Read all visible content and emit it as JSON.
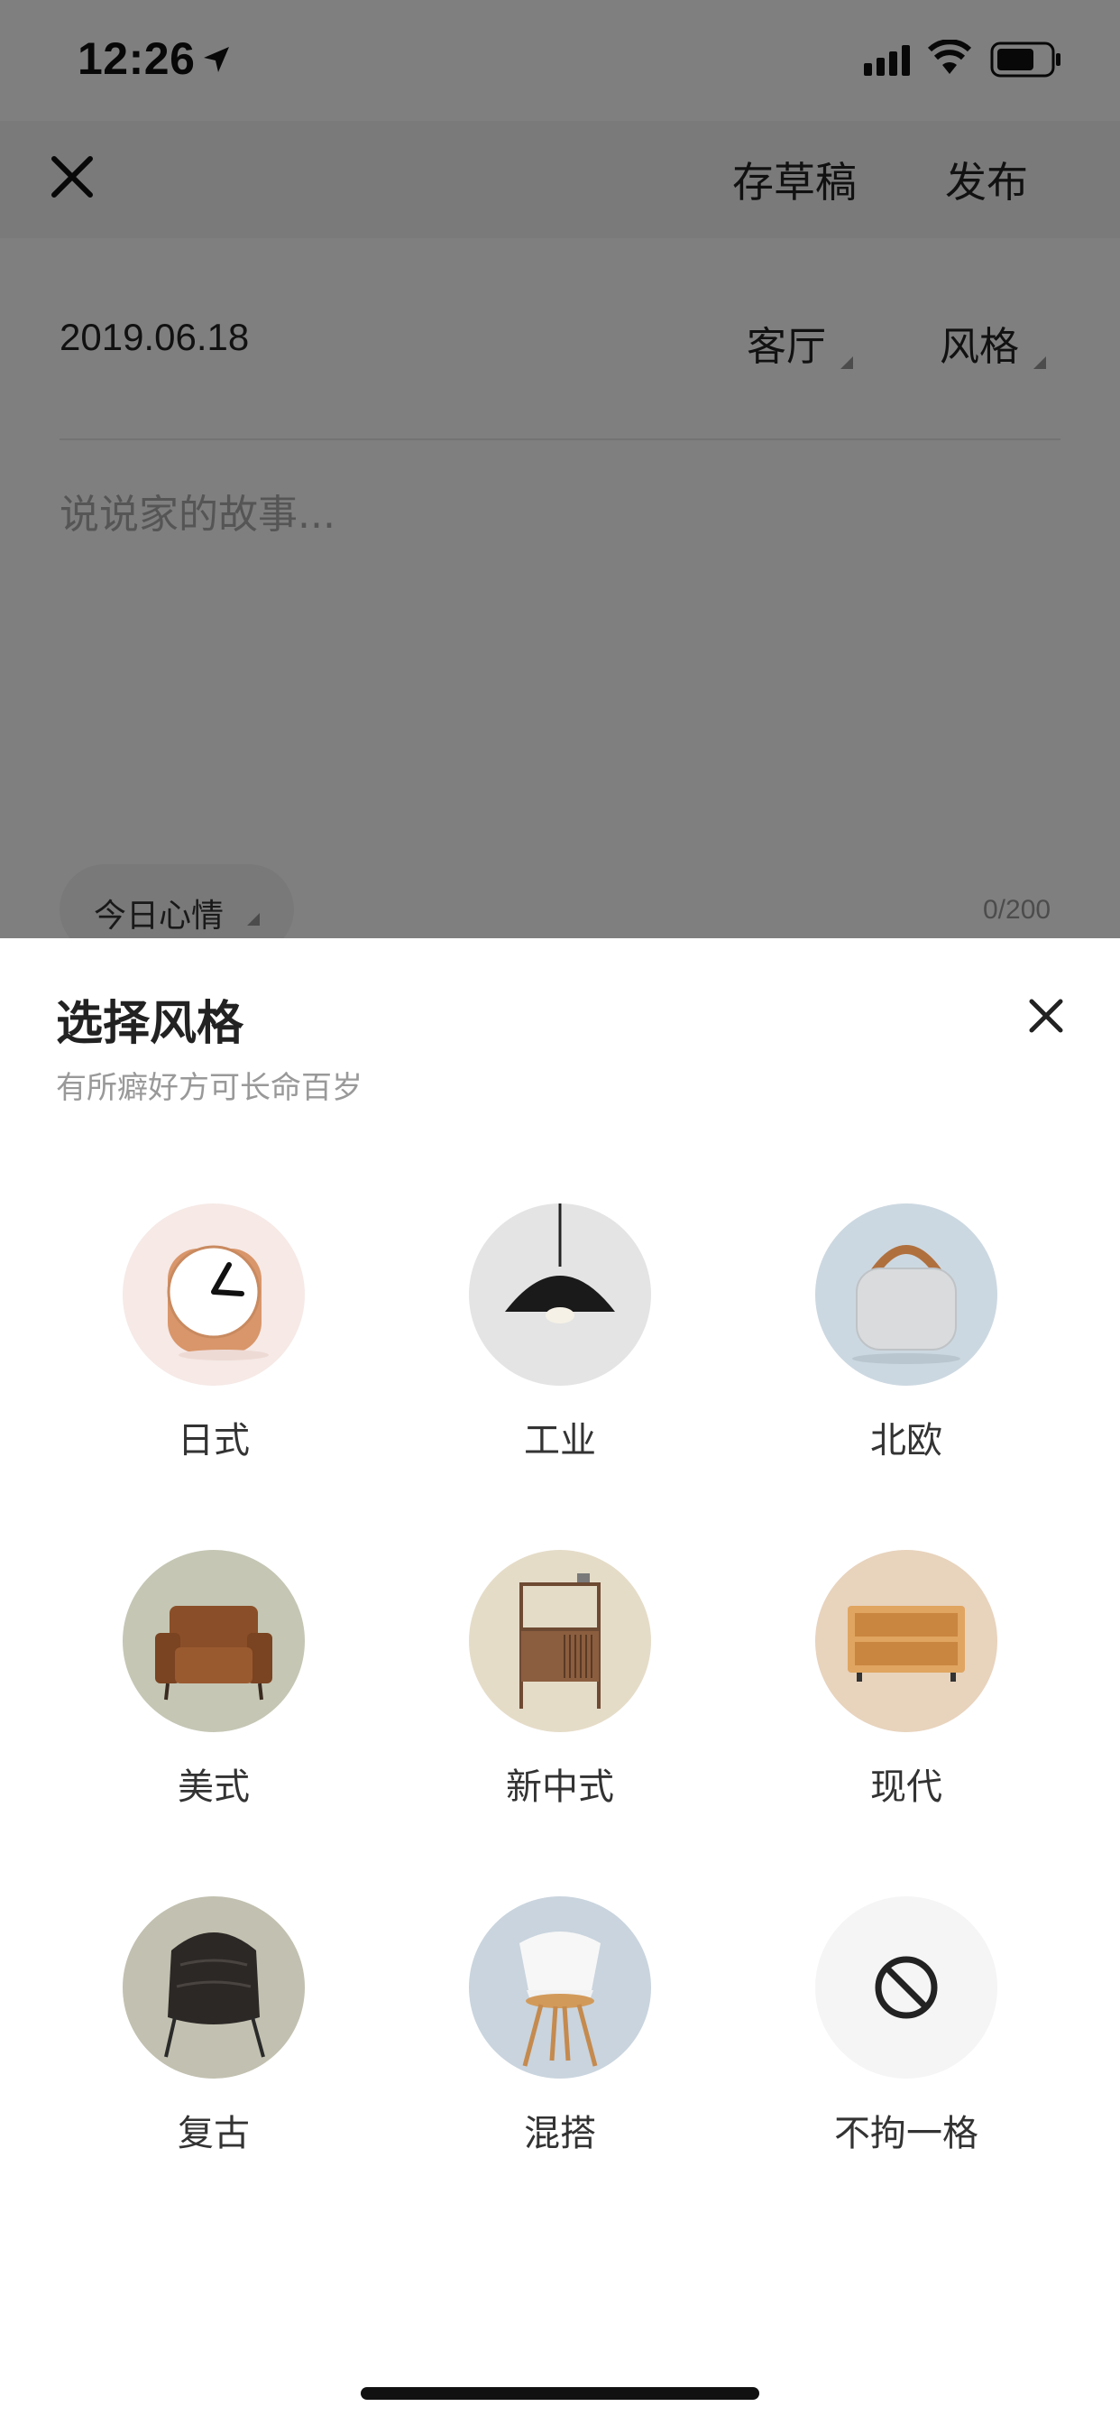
{
  "status_bar": {
    "time": "12:26",
    "icons": [
      "location-arrow-icon",
      "cellular-signal-icon",
      "wifi-icon",
      "battery-icon"
    ]
  },
  "header": {
    "close_icon": "close-icon",
    "save_draft": "存草稿",
    "publish": "发布"
  },
  "form": {
    "date": "2019.06.18",
    "room": "客厅",
    "style": "风格",
    "story_placeholder": "说说家的故事...",
    "mood": "今日心情",
    "counter": "0/200"
  },
  "sheet": {
    "title": "选择风格",
    "subtitle": "有所癖好方可长命百岁",
    "close_icon": "close-icon",
    "options": [
      {
        "label": "日式",
        "icon": "clock-icon"
      },
      {
        "label": "工业",
        "icon": "pendant-lamp-icon"
      },
      {
        "label": "北欧",
        "icon": "speaker-icon"
      },
      {
        "label": "美式",
        "icon": "armchair-icon"
      },
      {
        "label": "新中式",
        "icon": "cabinet-icon"
      },
      {
        "label": "现代",
        "icon": "tv-stand-icon"
      },
      {
        "label": "复古",
        "icon": "leather-chair-icon"
      },
      {
        "label": "混搭",
        "icon": "dining-chair-icon"
      },
      {
        "label": "不拘一格",
        "icon": "no-style-icon"
      }
    ]
  },
  "colors": {
    "overlay": "#000000",
    "sheet_bg": "#ffffff",
    "text_primary": "#222222",
    "text_secondary": "#999999"
  }
}
